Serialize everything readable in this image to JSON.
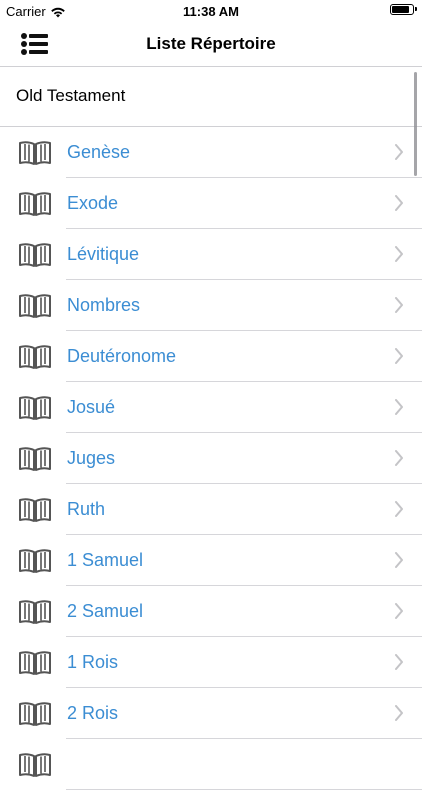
{
  "status_bar": {
    "carrier": "Carrier",
    "time": "11:38 AM",
    "battery_level": 0.92
  },
  "nav": {
    "title": "Liste Répertoire",
    "menu_icon": "list-menu-icon"
  },
  "section": {
    "title": "Old Testament"
  },
  "colors": {
    "accent": "#3b8dd3",
    "icon": "#555555",
    "divider": "#d6d6da"
  },
  "books": [
    {
      "label": "Genèse"
    },
    {
      "label": "Exode"
    },
    {
      "label": "Lévitique"
    },
    {
      "label": "Nombres"
    },
    {
      "label": "Deutéronome"
    },
    {
      "label": "Josué"
    },
    {
      "label": "Juges"
    },
    {
      "label": "Ruth"
    },
    {
      "label": "1 Samuel"
    },
    {
      "label": "2 Samuel"
    },
    {
      "label": "1 Rois"
    },
    {
      "label": "2 Rois"
    },
    {
      "label": ""
    }
  ]
}
